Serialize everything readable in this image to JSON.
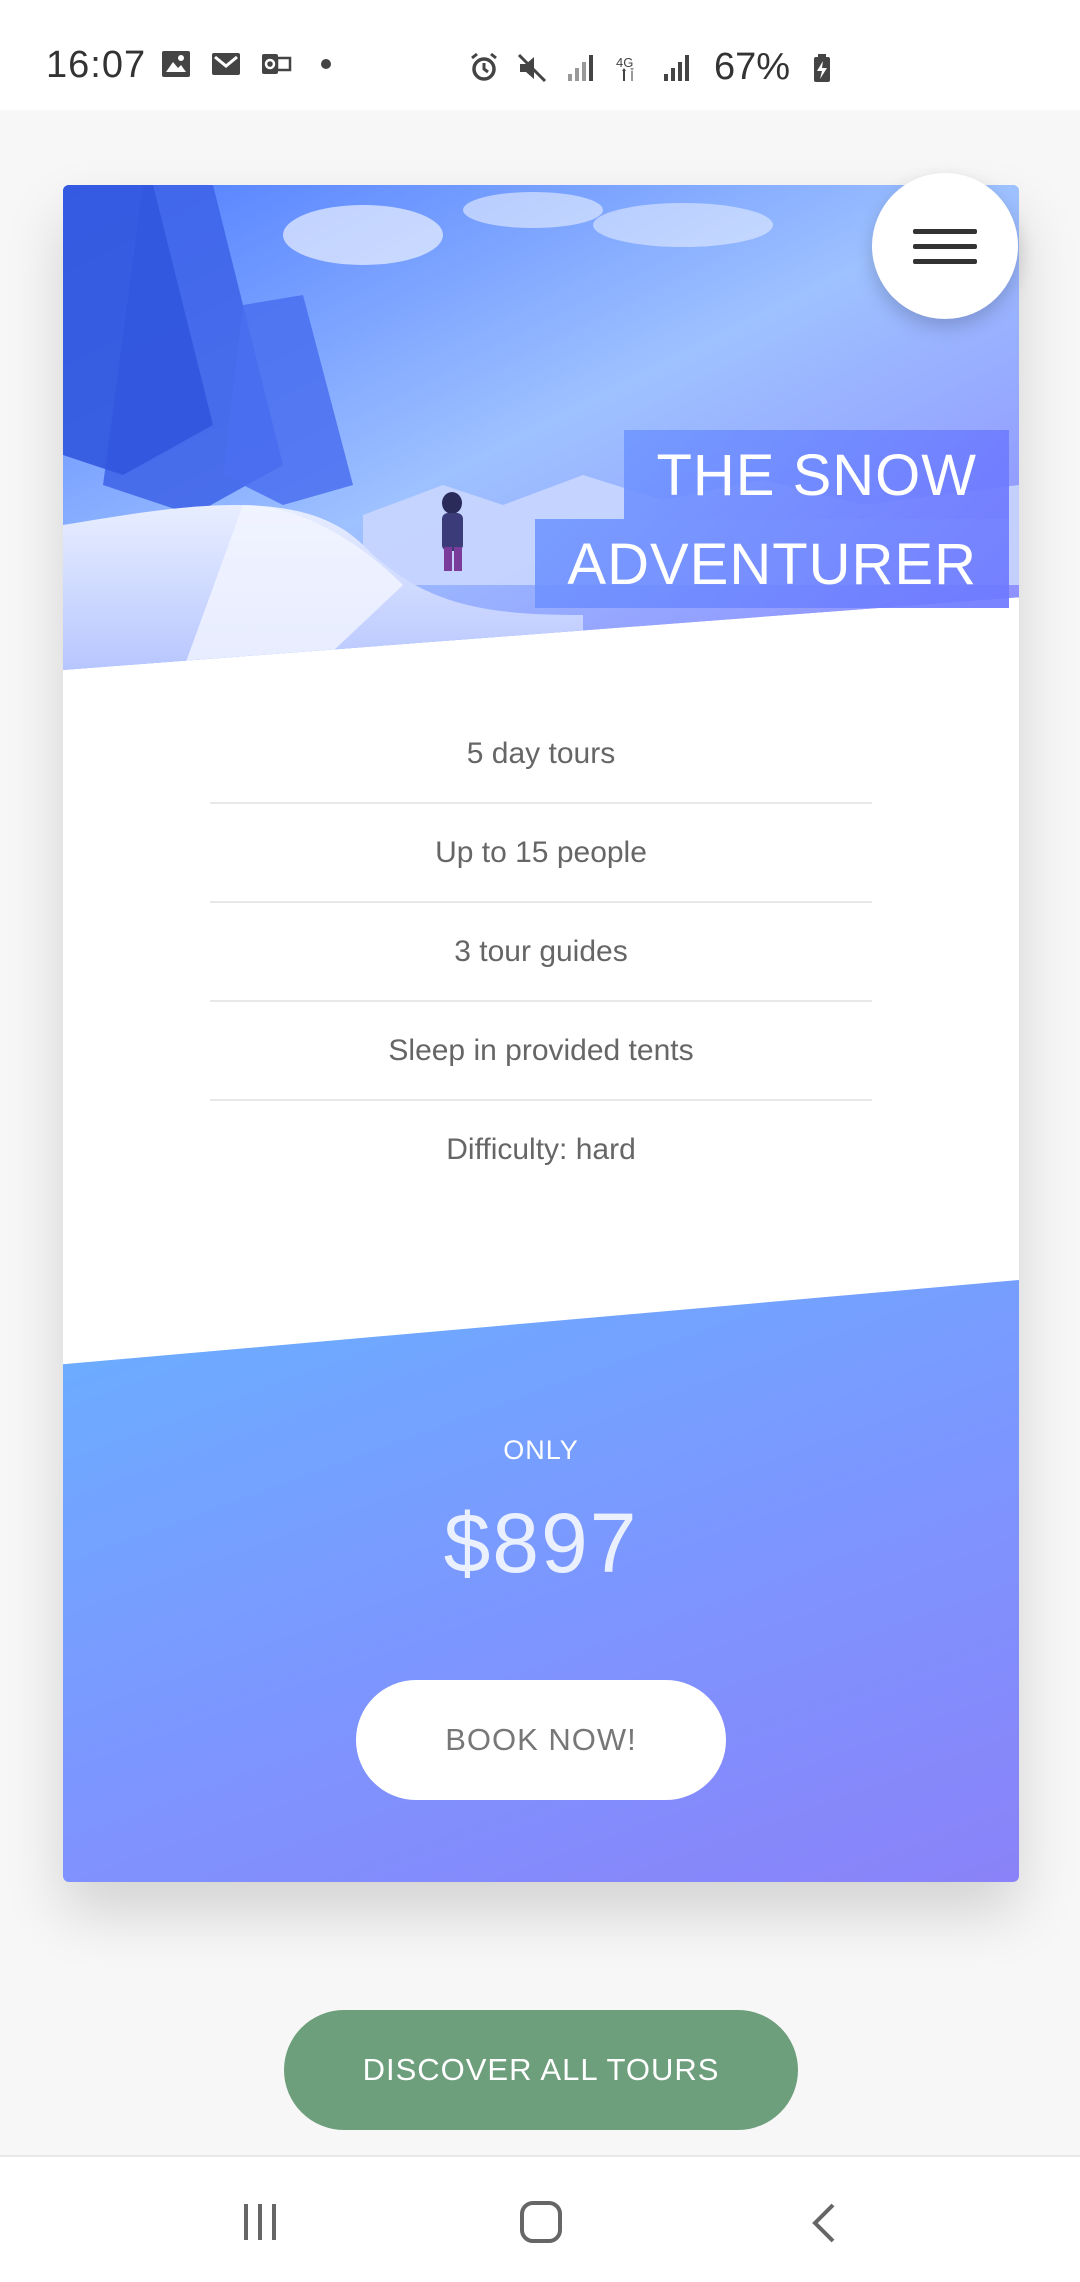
{
  "status_bar": {
    "time": "16:07",
    "battery": "67%",
    "network": "4G",
    "left_icons": [
      "gallery-icon",
      "gmail-icon",
      "outlook-icon",
      "dot-icon"
    ],
    "right_icons": [
      "alarm-icon",
      "mute-icon",
      "signal-icon",
      "data-4g-icon",
      "signal-icon",
      "battery-icon"
    ]
  },
  "tour": {
    "title_line1": "THE SNOW",
    "title_line2": "ADVENTURER",
    "features": [
      "5 day tours",
      "Up to 15 people",
      "3 tour guides",
      "Sleep in provided tents",
      "Difficulty: hard"
    ],
    "price_label": "ONLY",
    "price": "$897",
    "book_label": "BOOK NOW!"
  },
  "discover_label": "DISCOVER ALL TOURS",
  "colors": {
    "gradient_start": "#69b0ff",
    "gradient_end": "#8a82f8",
    "discover_button": "#6e9f7c"
  },
  "nav_bar": {
    "buttons": [
      "recent-apps-icon",
      "home-icon",
      "back-icon"
    ]
  }
}
